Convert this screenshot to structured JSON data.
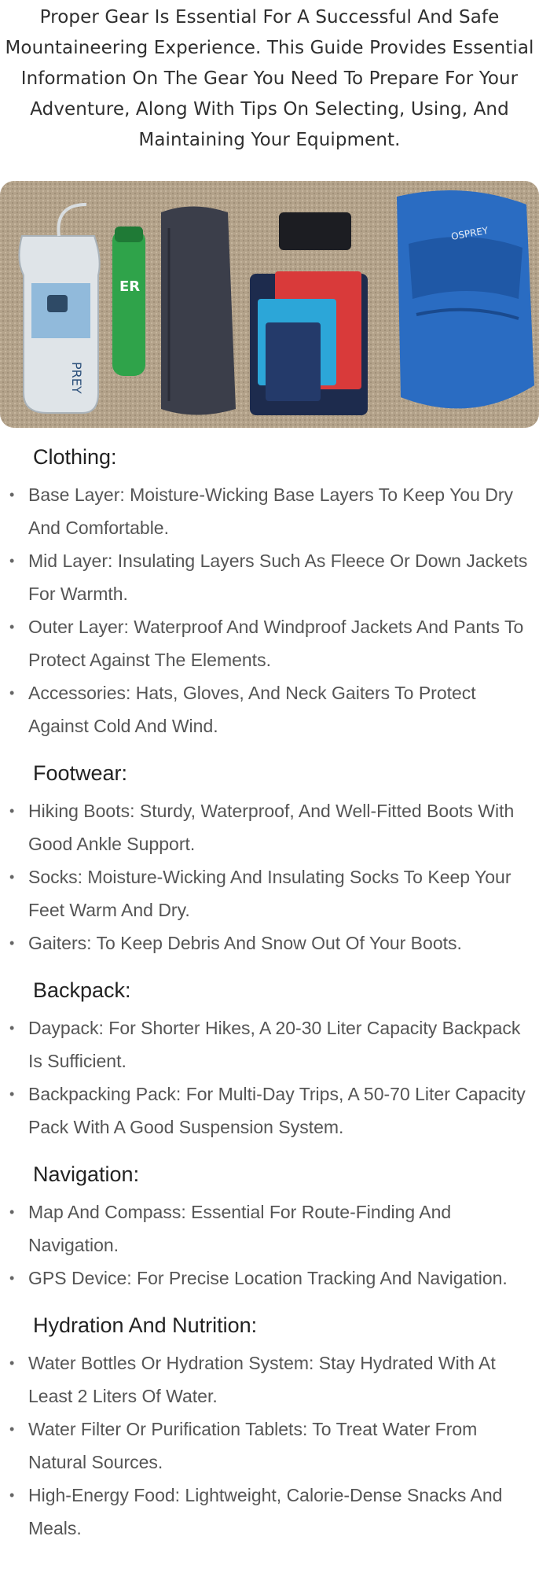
{
  "intro": "Proper Gear Is Essential For A Successful And Safe Mountaineering Experience. This Guide Provides Essential Information On The Gear You Need To Prepare For Your Adventure, Along With Tips On Selecting, Using, And Maintaining Your Equipment.",
  "image": {
    "bag_text_1": "ER",
    "bag_text_2": "PREY",
    "brand_text": "OSPREY"
  },
  "sections": [
    {
      "title": "Clothing:",
      "items": [
        "Base Layer: Moisture-Wicking Base Layers To Keep You Dry And Comfortable.",
        "Mid Layer: Insulating Layers Such As Fleece Or Down Jackets For Warmth.",
        "Outer Layer: Waterproof And Windproof Jackets And Pants To Protect Against The Elements.",
        "Accessories: Hats, Gloves, And Neck Gaiters To Protect Against Cold And Wind."
      ]
    },
    {
      "title": "Footwear:",
      "items": [
        "Hiking Boots: Sturdy, Waterproof, And Well-Fitted Boots With Good Ankle Support.",
        "Socks: Moisture-Wicking And Insulating Socks To Keep Your Feet Warm And Dry.",
        "Gaiters: To Keep Debris And Snow Out Of Your Boots."
      ]
    },
    {
      "title": "Backpack:",
      "items": [
        "Daypack: For Shorter Hikes, A 20-30 Liter Capacity Backpack Is Sufficient.",
        "Backpacking Pack: For Multi-Day Trips, A 50-70 Liter Capacity Pack With A Good Suspension System."
      ]
    },
    {
      "title": "Navigation:",
      "items": [
        "Map And Compass: Essential For Route-Finding And Navigation.",
        "GPS Device: For Precise Location Tracking And Navigation."
      ]
    },
    {
      "title": "Hydration And Nutrition:",
      "items": [
        "Water Bottles Or Hydration System: Stay Hydrated With At Least 2 Liters Of Water.",
        "Water Filter Or Purification Tablets: To Treat Water From Natural Sources.",
        "High-Energy Food: Lightweight, Calorie-Dense Snacks And Meals."
      ]
    }
  ]
}
